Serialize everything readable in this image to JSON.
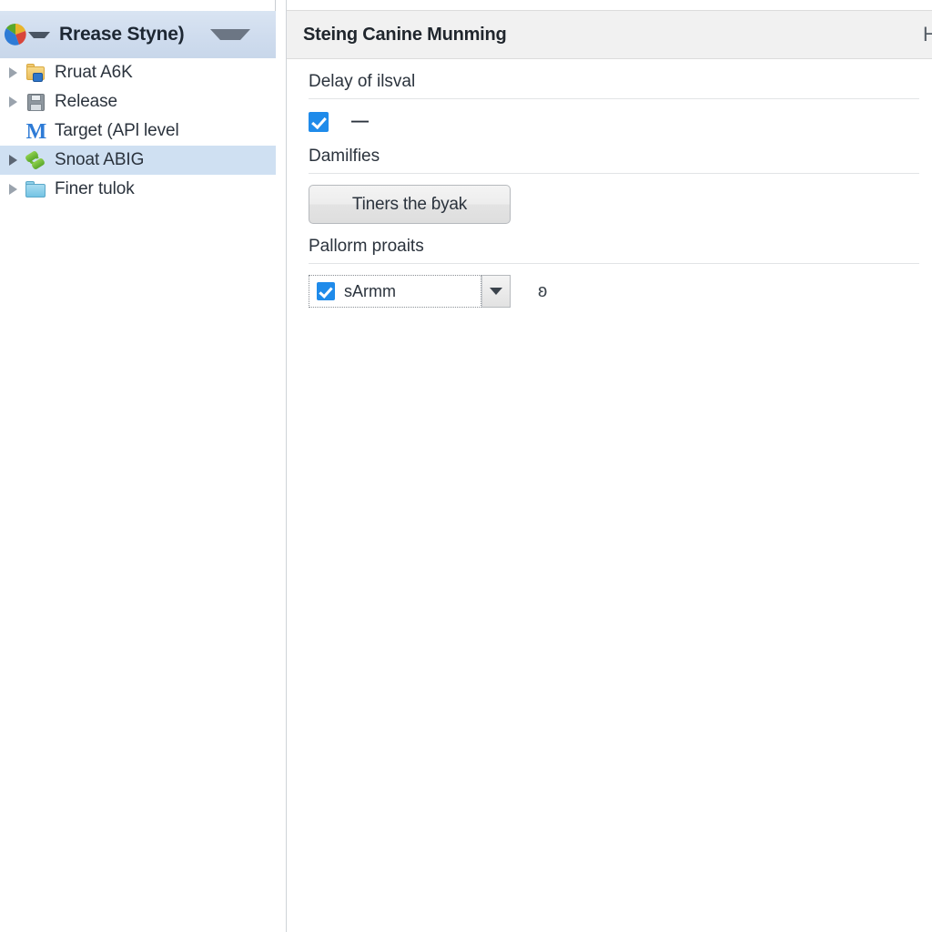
{
  "tree_panel": {
    "header": {
      "icon": "pinwheel-icon",
      "dropdown_caret_icon": "chevron-down-icon",
      "title": "Rrease Styne)",
      "menu_caret_icon": "triangle-down-icon"
    },
    "items": [
      {
        "label": "Rruat A6K",
        "icon": "folder-badge-icon",
        "expandable": true,
        "selected": false
      },
      {
        "label": "Release",
        "icon": "save-disk-icon",
        "expandable": true,
        "selected": false
      },
      {
        "label": "Target (APl level",
        "icon": "letter-m-icon",
        "expandable": false,
        "selected": false
      },
      {
        "label": "Snoat ABIG",
        "icon": "recycle-arrows-icon",
        "expandable": true,
        "selected": true
      },
      {
        "label": "Finer tulok",
        "icon": "folder-blue-icon",
        "expandable": true,
        "selected": false
      }
    ]
  },
  "detail_panel": {
    "header": {
      "title": "Steing Canine Munming",
      "right_glyph": "H"
    },
    "sections": [
      {
        "label": "Delay of ilsval",
        "checkbox_checked": true,
        "checkbox_label": "—"
      },
      {
        "label": "Damilfies",
        "button_label": "Tiners the ɓyak"
      },
      {
        "label": "Pallorm proaits",
        "combo_checked": true,
        "combo_value": "sArmm",
        "combo_arrow_icon": "triangle-down-icon",
        "side_glyph": "ʚ"
      }
    ]
  },
  "colors": {
    "tree_header_bg": "#cfdcee",
    "selection_bg": "#cfe0f2",
    "detail_header_bg": "#f1f1f1",
    "accent_blue": "#1f8bea",
    "rule": "#e2e4e6",
    "text": "#2b333d"
  }
}
